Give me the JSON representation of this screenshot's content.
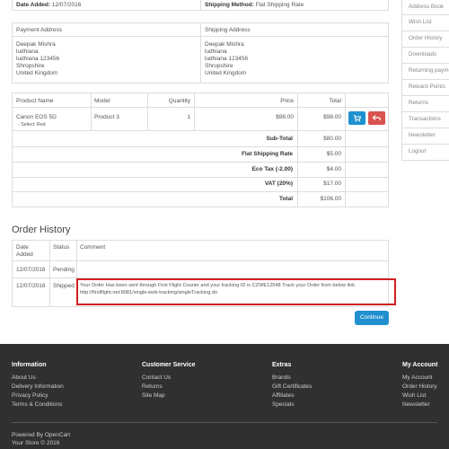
{
  "order": {
    "date_added_label": "Date Added:",
    "date_added": "12/07/2016",
    "shipping_method_label": "Shipping Method:",
    "shipping_method": "Flat Shipping Rate"
  },
  "addresses": {
    "payment_header": "Payment Address",
    "shipping_header": "Shipping Address",
    "payment_lines": [
      "Deepak Mishra",
      "ludhiana",
      "ludhiana 123456",
      "Shropshire",
      "United Kingdom"
    ],
    "shipping_lines": [
      "Deepak Mishra",
      "ludhiana",
      "ludhiana 123456",
      "Shropshire",
      "United Kingdom"
    ]
  },
  "products": {
    "headers": {
      "name": "Product Name",
      "model": "Model",
      "quantity": "Quantity",
      "price": "Price",
      "total": "Total"
    },
    "rows": [
      {
        "name": "Canon EOS 5D",
        "option": "- Select: Red",
        "model": "Product 3",
        "quantity": "1",
        "price": "$98.00",
        "total": "$98.00"
      }
    ],
    "totals": [
      {
        "label": "Sub-Total",
        "value": "$80.00"
      },
      {
        "label": "Flat Shipping Rate",
        "value": "$5.00"
      },
      {
        "label": "Eco Tax (-2.00)",
        "value": "$4.00"
      },
      {
        "label": "VAT (20%)",
        "value": "$17.00"
      },
      {
        "label": "Total",
        "value": "$106.00"
      }
    ]
  },
  "history": {
    "title": "Order History",
    "headers": {
      "date": "Date Added",
      "status": "Status",
      "comment": "Comment"
    },
    "rows": [
      {
        "date": "12/07/2016",
        "status": "Pending",
        "comment_1": "",
        "comment_2": ""
      },
      {
        "date": "12/07/2016",
        "status": "Shipped",
        "comment_1": "Your Order Has been sent through First Flight Courier and your tracking ID is CZWE12548 Track your Order from below link",
        "comment_2": "http://firstflight.net:8081/single-web-tracking/singleTracking.do"
      }
    ],
    "continue_label": "Continue"
  },
  "sidebar": {
    "items": [
      "Address Book",
      "Wish List",
      "Order History",
      "Downloads",
      "Returning payments",
      "Reward Points",
      "Returns",
      "Transactions",
      "Newsletter",
      "Logout"
    ]
  },
  "footer": {
    "information": {
      "title": "Information",
      "links": [
        "About Us",
        "Delivery Information",
        "Privacy Policy",
        "Terms & Conditions"
      ]
    },
    "customer_service": {
      "title": "Customer Service",
      "links": [
        "Contact Us",
        "Returns",
        "Site Map"
      ]
    },
    "extras": {
      "title": "Extras",
      "links": [
        "Brands",
        "Gift Certificates",
        "Affiliates",
        "Specials"
      ]
    },
    "my_account": {
      "title": "My Account",
      "links": [
        "My Account",
        "Order History",
        "Wish List",
        "Newsletter"
      ]
    },
    "powered_by": "Powered By OpenCart",
    "copyright": "Your Store © 2016"
  },
  "colors": {
    "accent": "#1e91cf",
    "danger": "#d9534f",
    "highlight": "#d21f1f",
    "footer_bg": "#303030"
  },
  "icons": {
    "add_to_cart": "shopping-cart-icon",
    "return": "reply-icon"
  }
}
